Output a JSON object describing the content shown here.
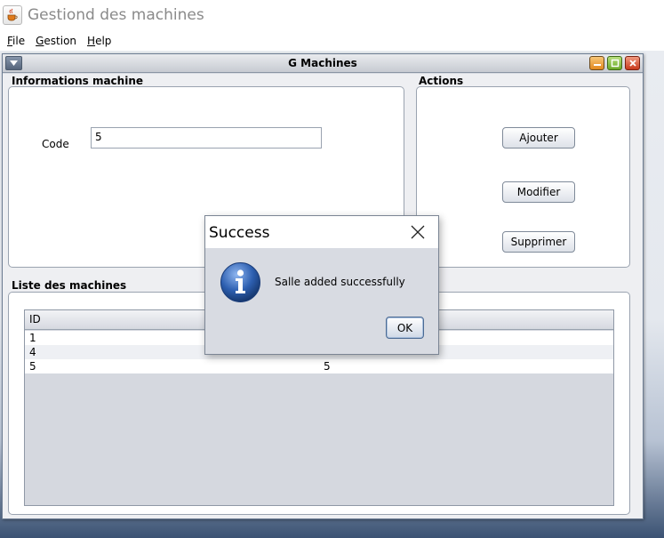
{
  "app": {
    "title": "Gestiond des machines"
  },
  "menubar": {
    "items": [
      "File",
      "Gestion",
      "Help"
    ]
  },
  "frame": {
    "title": "G Machines"
  },
  "info_panel": {
    "title": "Informations machine",
    "code_label": "Code",
    "code_value": "5"
  },
  "actions_panel": {
    "title": "Actions",
    "add_label": "Ajouter",
    "modify_label": "Modifier",
    "delete_label": "Supprimer"
  },
  "list_panel": {
    "title": "Liste des machines",
    "columns": [
      "ID",
      ""
    ],
    "rows": [
      [
        "1",
        ""
      ],
      [
        "4",
        ""
      ],
      [
        "5",
        "5"
      ]
    ]
  },
  "dialog": {
    "title": "Success",
    "message": "Salle added successfully",
    "ok_label": "OK"
  },
  "icons": {
    "app": "java-cup-icon",
    "dialog": "info-icon",
    "close": "close-icon"
  },
  "colors": {
    "frame_bg": "#d8dbe2",
    "panel_bg": "#ffffff",
    "accent": "#2d5fb0"
  }
}
